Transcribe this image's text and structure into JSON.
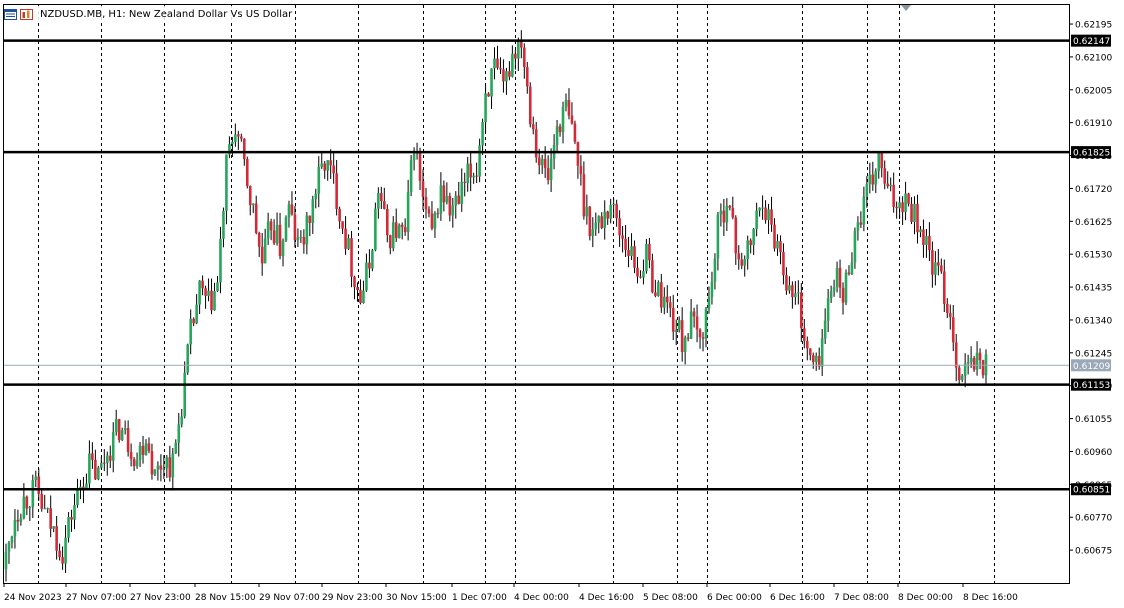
{
  "header": {
    "title": "NZDUSD.MB, H1:  New Zealand Dollar Vs US Dollar",
    "icons": [
      "chart-window-icon",
      "indicator-list-icon"
    ]
  },
  "colors": {
    "bull": "#26a65b",
    "bear": "#d42a38",
    "wick": "#000000",
    "grid": "#000000",
    "bid_line": "#9aa9b8",
    "level_line": "#000000",
    "level_label_bg": "#000000",
    "level_label_text": "#ffffff",
    "bid_label_bg": "#9aa9b8"
  },
  "chart_data": {
    "type": "candlestick",
    "title": "NZDUSD.MB, H1:  New Zealand Dollar Vs US Dollar",
    "symbol": "NZDUSD.MB",
    "timeframe": "H1",
    "grid": "vertical dashed",
    "ylim": [
      0.6058,
      0.6225
    ],
    "y_ticks": [
      "0.62195",
      "0.62100",
      "0.62005",
      "0.61910",
      "0.61815",
      "0.61720",
      "0.61625",
      "0.61530",
      "0.61435",
      "0.61340",
      "0.61245",
      "0.61150",
      "0.61055",
      "0.60960",
      "0.60865",
      "0.60770",
      "0.60675"
    ],
    "x_labels": [
      "24 Nov 2023",
      "27 Nov 07:00",
      "27 Nov 23:00",
      "28 Nov 15:00",
      "29 Nov 07:00",
      "29 Nov 23:00",
      "30 Nov 15:00",
      "1 Dec 07:00",
      "4 Dec 00:00",
      "4 Dec 16:00",
      "5 Dec 08:00",
      "6 Dec 00:00",
      "6 Dec 16:00",
      "7 Dec 08:00",
      "8 Dec 00:00",
      "8 Dec 16:00"
    ],
    "horizontal_levels": [
      "0.62147",
      "0.61825",
      "0.61153",
      "0.60851"
    ],
    "current_bid": "0.61209",
    "close_path": [
      [
        0,
        0.6065
      ],
      [
        3,
        0.6078
      ],
      [
        6,
        0.6082
      ],
      [
        10,
        0.6085
      ],
      [
        13,
        0.6078
      ],
      [
        16,
        0.6073
      ],
      [
        19,
        0.6067
      ],
      [
        22,
        0.6078
      ],
      [
        25,
        0.6086
      ],
      [
        28,
        0.6092
      ],
      [
        31,
        0.6089
      ],
      [
        34,
        0.6096
      ],
      [
        38,
        0.6103
      ],
      [
        41,
        0.6099
      ],
      [
        44,
        0.6094
      ],
      [
        47,
        0.6101
      ],
      [
        50,
        0.6089
      ],
      [
        53,
        0.6094
      ],
      [
        56,
        0.6092
      ],
      [
        59,
        0.611
      ],
      [
        62,
        0.613
      ],
      [
        65,
        0.6142
      ],
      [
        68,
        0.6138
      ],
      [
        71,
        0.6144
      ],
      [
        74,
        0.6178
      ],
      [
        77,
        0.619
      ],
      [
        80,
        0.6178
      ],
      [
        83,
        0.6165
      ],
      [
        86,
        0.615
      ],
      [
        89,
        0.6162
      ],
      [
        92,
        0.6155
      ],
      [
        95,
        0.6166
      ],
      [
        98,
        0.6155
      ],
      [
        101,
        0.616
      ],
      [
        104,
        0.6172
      ],
      [
        107,
        0.618
      ],
      [
        110,
        0.6174
      ],
      [
        113,
        0.6162
      ],
      [
        116,
        0.615
      ],
      [
        119,
        0.614
      ],
      [
        122,
        0.615
      ],
      [
        125,
        0.6172
      ],
      [
        128,
        0.6158
      ],
      [
        131,
        0.616
      ],
      [
        134,
        0.6158
      ],
      [
        137,
        0.6186
      ],
      [
        140,
        0.6168
      ],
      [
        143,
        0.6158
      ],
      [
        146,
        0.6172
      ],
      [
        149,
        0.6165
      ],
      [
        152,
        0.6168
      ],
      [
        155,
        0.6175
      ],
      [
        158,
        0.6178
      ],
      [
        161,
        0.62
      ],
      [
        164,
        0.6206
      ],
      [
        167,
        0.62
      ],
      [
        170,
        0.6211
      ],
      [
        173,
        0.6216
      ],
      [
        176,
        0.6195
      ],
      [
        179,
        0.618
      ],
      [
        182,
        0.6175
      ],
      [
        185,
        0.619
      ],
      [
        188,
        0.6195
      ],
      [
        191,
        0.6185
      ],
      [
        194,
        0.6168
      ],
      [
        197,
        0.616
      ],
      [
        200,
        0.6163
      ],
      [
        203,
        0.6168
      ],
      [
        206,
        0.616
      ],
      [
        209,
        0.6155
      ],
      [
        212,
        0.6148
      ],
      [
        215,
        0.6152
      ],
      [
        218,
        0.6143
      ],
      [
        221,
        0.614
      ],
      [
        224,
        0.6134
      ],
      [
        227,
        0.6128
      ],
      [
        230,
        0.6133
      ],
      [
        233,
        0.6128
      ],
      [
        236,
        0.614
      ],
      [
        239,
        0.616
      ],
      [
        242,
        0.617
      ],
      [
        245,
        0.6155
      ],
      [
        248,
        0.615
      ],
      [
        251,
        0.616
      ],
      [
        254,
        0.617
      ],
      [
        257,
        0.616
      ],
      [
        260,
        0.6154
      ],
      [
        263,
        0.6142
      ],
      [
        266,
        0.614
      ],
      [
        269,
        0.6124
      ],
      [
        272,
        0.612
      ],
      [
        275,
        0.6133
      ],
      [
        278,
        0.6148
      ],
      [
        281,
        0.614
      ],
      [
        284,
        0.6155
      ],
      [
        287,
        0.6165
      ],
      [
        290,
        0.6172
      ],
      [
        293,
        0.618
      ],
      [
        296,
        0.617
      ],
      [
        299,
        0.6168
      ],
      [
        302,
        0.617
      ],
      [
        305,
        0.6165
      ],
      [
        308,
        0.6158
      ],
      [
        311,
        0.615
      ],
      [
        314,
        0.6145
      ],
      [
        317,
        0.6135
      ],
      [
        320,
        0.6118
      ],
      [
        323,
        0.612
      ],
      [
        326,
        0.6122
      ],
      [
        329,
        0.6121
      ]
    ]
  }
}
